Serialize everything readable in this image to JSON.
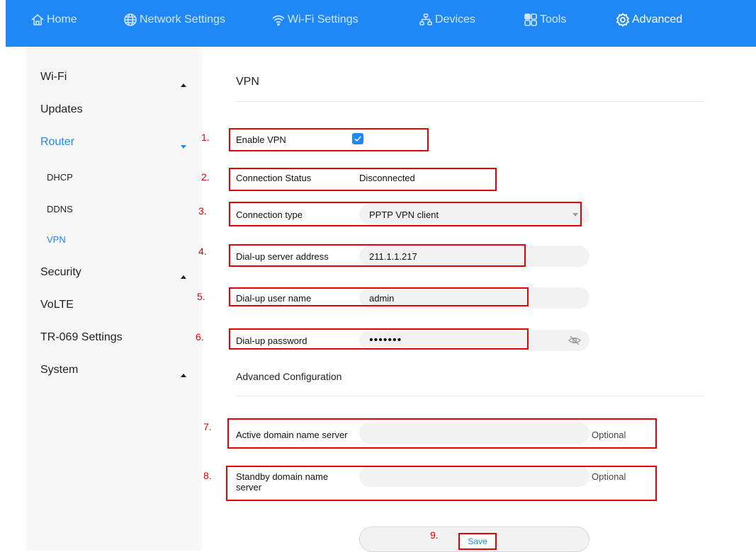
{
  "nav": {
    "home": "Home",
    "network": "Network Settings",
    "wifi": "Wi-Fi Settings",
    "devices": "Devices",
    "tools": "Tools",
    "advanced": "Advanced"
  },
  "sidebar": {
    "items": [
      {
        "label": "Wi-Fi"
      },
      {
        "label": "Updates"
      },
      {
        "label": "Router"
      },
      {
        "label": "DHCP"
      },
      {
        "label": "DDNS"
      },
      {
        "label": "VPN"
      },
      {
        "label": "Security"
      },
      {
        "label": "VoLTE"
      },
      {
        "label": "TR-069 Settings"
      },
      {
        "label": "System"
      }
    ]
  },
  "vpn": {
    "title": "VPN",
    "enable_label": "Enable VPN",
    "enable_checked": true,
    "status_label": "Connection Status",
    "status_value": "Disconnected",
    "type_label": "Connection type",
    "type_value": "PPTP VPN client",
    "server_label": "Dial-up server address",
    "server_value": "211.1.1.217",
    "user_label": "Dial-up user name",
    "user_value": "admin",
    "password_label": "Dial-up password",
    "password_value": "•••••••"
  },
  "advanced": {
    "title": "Advanced Configuration",
    "active_dns_label": "Active domain name server",
    "active_dns_value": "",
    "active_dns_hint": "Optional",
    "standby_dns_label": "Standby domain name server",
    "standby_dns_value": "",
    "standby_dns_hint": "Optional"
  },
  "save_label": "Save",
  "annotations": [
    "1.",
    "2.",
    "3.",
    "4.",
    "5.",
    "6.",
    "7.",
    "8.",
    "9."
  ],
  "colors": {
    "accent": "#1f88f5",
    "highlight": "#e60000"
  }
}
